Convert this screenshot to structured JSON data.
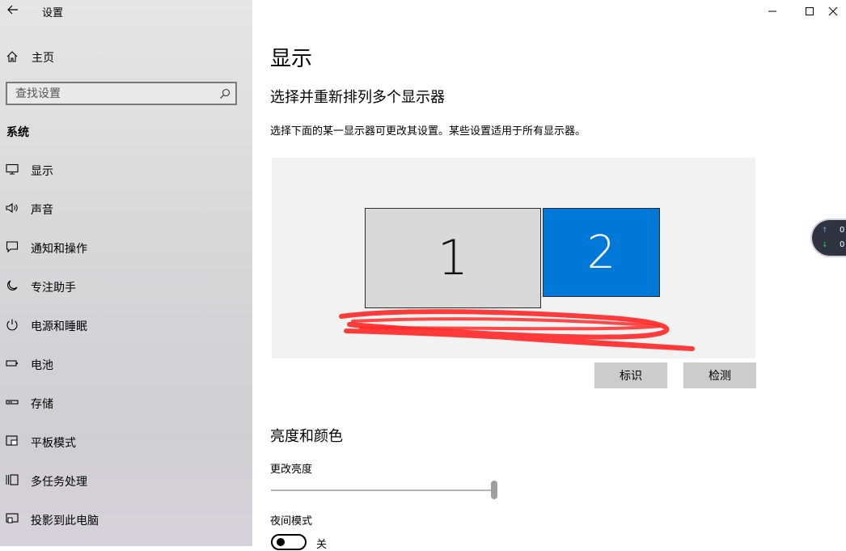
{
  "window": {
    "title": "设置"
  },
  "sidebar": {
    "home_label": "主页",
    "search_placeholder": "查找设置",
    "section": "系统",
    "items": [
      {
        "label": "显示",
        "icon": "monitor-icon"
      },
      {
        "label": "声音",
        "icon": "speaker-icon"
      },
      {
        "label": "通知和操作",
        "icon": "notification-icon"
      },
      {
        "label": "专注助手",
        "icon": "moon-icon"
      },
      {
        "label": "电源和睡眠",
        "icon": "power-icon"
      },
      {
        "label": "电池",
        "icon": "battery-icon"
      },
      {
        "label": "存储",
        "icon": "storage-icon"
      },
      {
        "label": "平板模式",
        "icon": "tablet-icon"
      },
      {
        "label": "多任务处理",
        "icon": "multitask-icon"
      },
      {
        "label": "投影到此电脑",
        "icon": "project-icon"
      }
    ]
  },
  "main": {
    "title": "显示",
    "arrange_heading": "选择并重新排列多个显示器",
    "arrange_desc": "选择下面的某一显示器可更改其设置。某些设置适用于所有显示器。",
    "monitors": [
      {
        "label": "1",
        "selected": false
      },
      {
        "label": "2",
        "selected": true
      }
    ],
    "identify_button": "标识",
    "detect_button": "检测",
    "brightness_heading": "亮度和颜色",
    "brightness_label": "更改亮度",
    "brightness_value": 1.0,
    "night_light_label": "夜间模式",
    "night_light_state": "关"
  },
  "network_widget": {
    "up_value": "0",
    "down_value": "0"
  },
  "colors": {
    "accent": "#0078d7",
    "annotation": "#ff2a2a"
  }
}
